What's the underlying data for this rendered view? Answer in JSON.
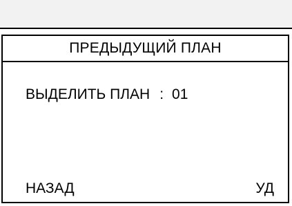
{
  "screen": {
    "title": "ПРЕДЫДУЩИЙ ПЛАН",
    "setting": {
      "label": "ВЫДЕЛИТЬ ПЛАН",
      "separator": ":",
      "value": "01"
    },
    "softkeys": {
      "left": "НАЗАД",
      "right": "УД"
    }
  }
}
